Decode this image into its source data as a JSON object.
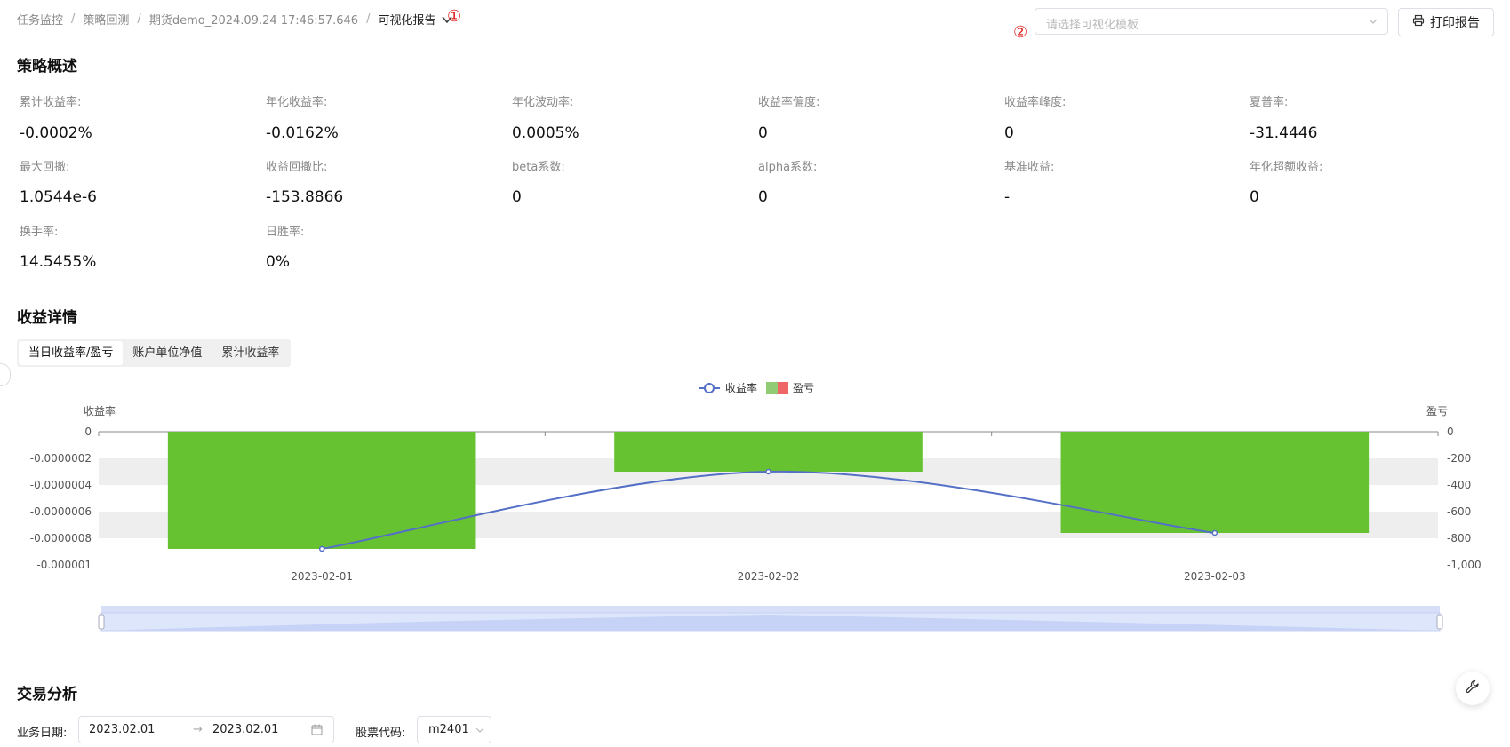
{
  "breadcrumb": {
    "items": [
      "任务监控",
      "策略回测",
      "期货demo_2024.09.24 17:46:57.646"
    ],
    "current": "可视化报告",
    "separator": "/"
  },
  "annotations": {
    "one": "①",
    "two": "②"
  },
  "template_select": {
    "placeholder": "请选择可视化模板"
  },
  "print_button": {
    "label": "打印报告",
    "icon": "printer-icon"
  },
  "overview": {
    "title": "策略概述",
    "stats": [
      {
        "label": "累计收益率:",
        "value": "-0.0002%"
      },
      {
        "label": "年化收益率:",
        "value": "-0.0162%"
      },
      {
        "label": "年化波动率:",
        "value": "0.0005%"
      },
      {
        "label": "收益率偏度:",
        "value": "0"
      },
      {
        "label": "收益率峰度:",
        "value": "0"
      },
      {
        "label": "夏普率:",
        "value": "-31.4446"
      },
      {
        "label": "最大回撤:",
        "value": "1.0544e-6"
      },
      {
        "label": "收益回撤比:",
        "value": "-153.8866"
      },
      {
        "label": "beta系数:",
        "value": "0"
      },
      {
        "label": "alpha系数:",
        "value": "0"
      },
      {
        "label": "基准收益:",
        "value": "-"
      },
      {
        "label": "年化超额收益:",
        "value": "0"
      },
      {
        "label": "换手率:",
        "value": "14.5455%"
      },
      {
        "label": "日胜率:",
        "value": "0%"
      }
    ]
  },
  "returns": {
    "title": "收益详情",
    "tabs": [
      "当日收益率/盈亏",
      "账户单位净值",
      "累计收益率"
    ],
    "active_tab": 0
  },
  "chart_data": {
    "type": "bar",
    "categories": [
      "2023-02-01",
      "2023-02-02",
      "2023-02-03"
    ],
    "series": [
      {
        "name": "收益率",
        "type": "line",
        "axis": "left",
        "values": [
          -8.8e-07,
          -3e-07,
          -7.6e-07
        ],
        "color": "#5470c6"
      },
      {
        "name": "盈亏",
        "type": "bar",
        "axis": "right",
        "values": [
          -880,
          -300,
          -760
        ],
        "color": "#67c232"
      }
    ],
    "left_axis": {
      "label": "收益率",
      "ticks": [
        "0",
        "-0.0000002",
        "-0.0000004",
        "-0.0000006",
        "-0.0000008",
        "-0.000001"
      ],
      "range": [
        -1e-06,
        0
      ]
    },
    "right_axis": {
      "label": "盈亏",
      "ticks": [
        "0",
        "-200",
        "-400",
        "-600",
        "-800",
        "-1,000"
      ],
      "range": [
        -1000,
        0
      ]
    },
    "legend": [
      "收益率",
      "盈亏"
    ],
    "legend_position": "top-center",
    "grid": true
  },
  "trade": {
    "title": "交易分析",
    "date_label": "业务日期:",
    "date_start": "2023.02.01",
    "date_end": "2023.02.01",
    "code_label": "股票代码:",
    "code_value": "m2401"
  },
  "colors": {
    "bar": "#67c232",
    "line": "#5470c6",
    "band": "#eeeeee",
    "annotation": "#e02020"
  }
}
